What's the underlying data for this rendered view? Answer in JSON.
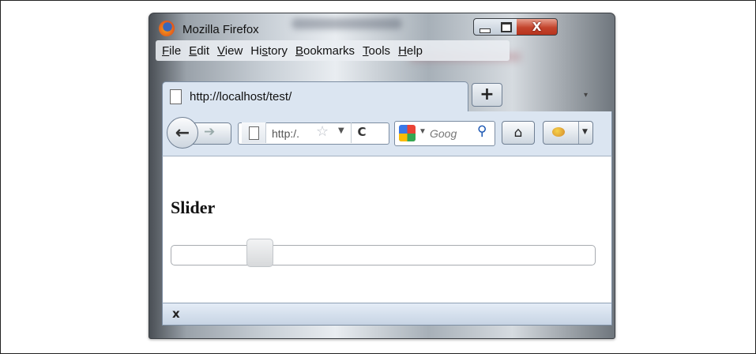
{
  "window": {
    "title": "Mozilla Firefox",
    "controls": {
      "minimize": "_",
      "maximize": "□",
      "close": "X"
    }
  },
  "menu": [
    "File",
    "Edit",
    "View",
    "History",
    "Bookmarks",
    "Tools",
    "Help"
  ],
  "tab": {
    "title": "http://localhost/test/",
    "new_tab": "+"
  },
  "toolbar": {
    "url_text": "http:/.",
    "reload": "C",
    "search_text": "Goog",
    "search_glyph": "⚲",
    "home_glyph": "⌂"
  },
  "page": {
    "heading": "Slider",
    "slider": {
      "value_fraction": 0.19
    }
  },
  "statusbar": {
    "close": "x"
  },
  "icons": [
    "firefox-logo-icon",
    "page-icon",
    "star-icon",
    "google-icon",
    "search-icon",
    "home-icon",
    "addon-bug-icon"
  ]
}
